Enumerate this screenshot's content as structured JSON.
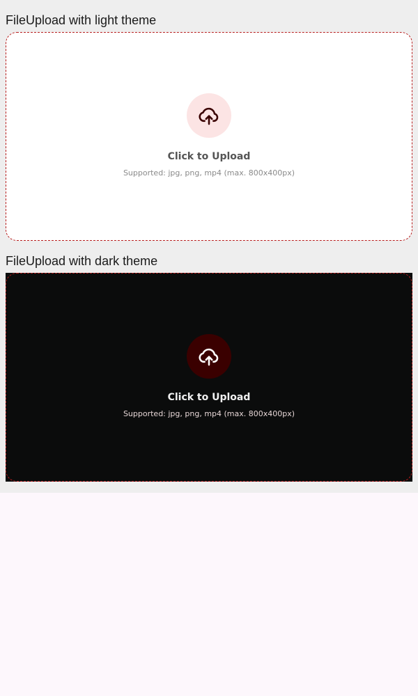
{
  "sections": {
    "light": {
      "title": "FileUpload with light theme",
      "upload_label": "Click to Upload",
      "hint": "Supported: jpg, png, mp4 (max. 800x400px)",
      "icon": "cloud-upload-icon",
      "colors": {
        "background": "#ffffff",
        "border": "#b71c1c",
        "icon_bg": "#fce4e4",
        "icon_color": "#3a0000"
      }
    },
    "dark": {
      "title": "FileUpload with dark theme",
      "upload_label": "Click to Upload",
      "hint": "Supported: jpg, png, mp4 (max. 800x400px)",
      "icon": "cloud-upload-icon",
      "colors": {
        "background": "#0b0c0c",
        "border": "#b71c1c",
        "icon_bg": "#3a0000",
        "icon_color": "#ffffff"
      }
    }
  }
}
